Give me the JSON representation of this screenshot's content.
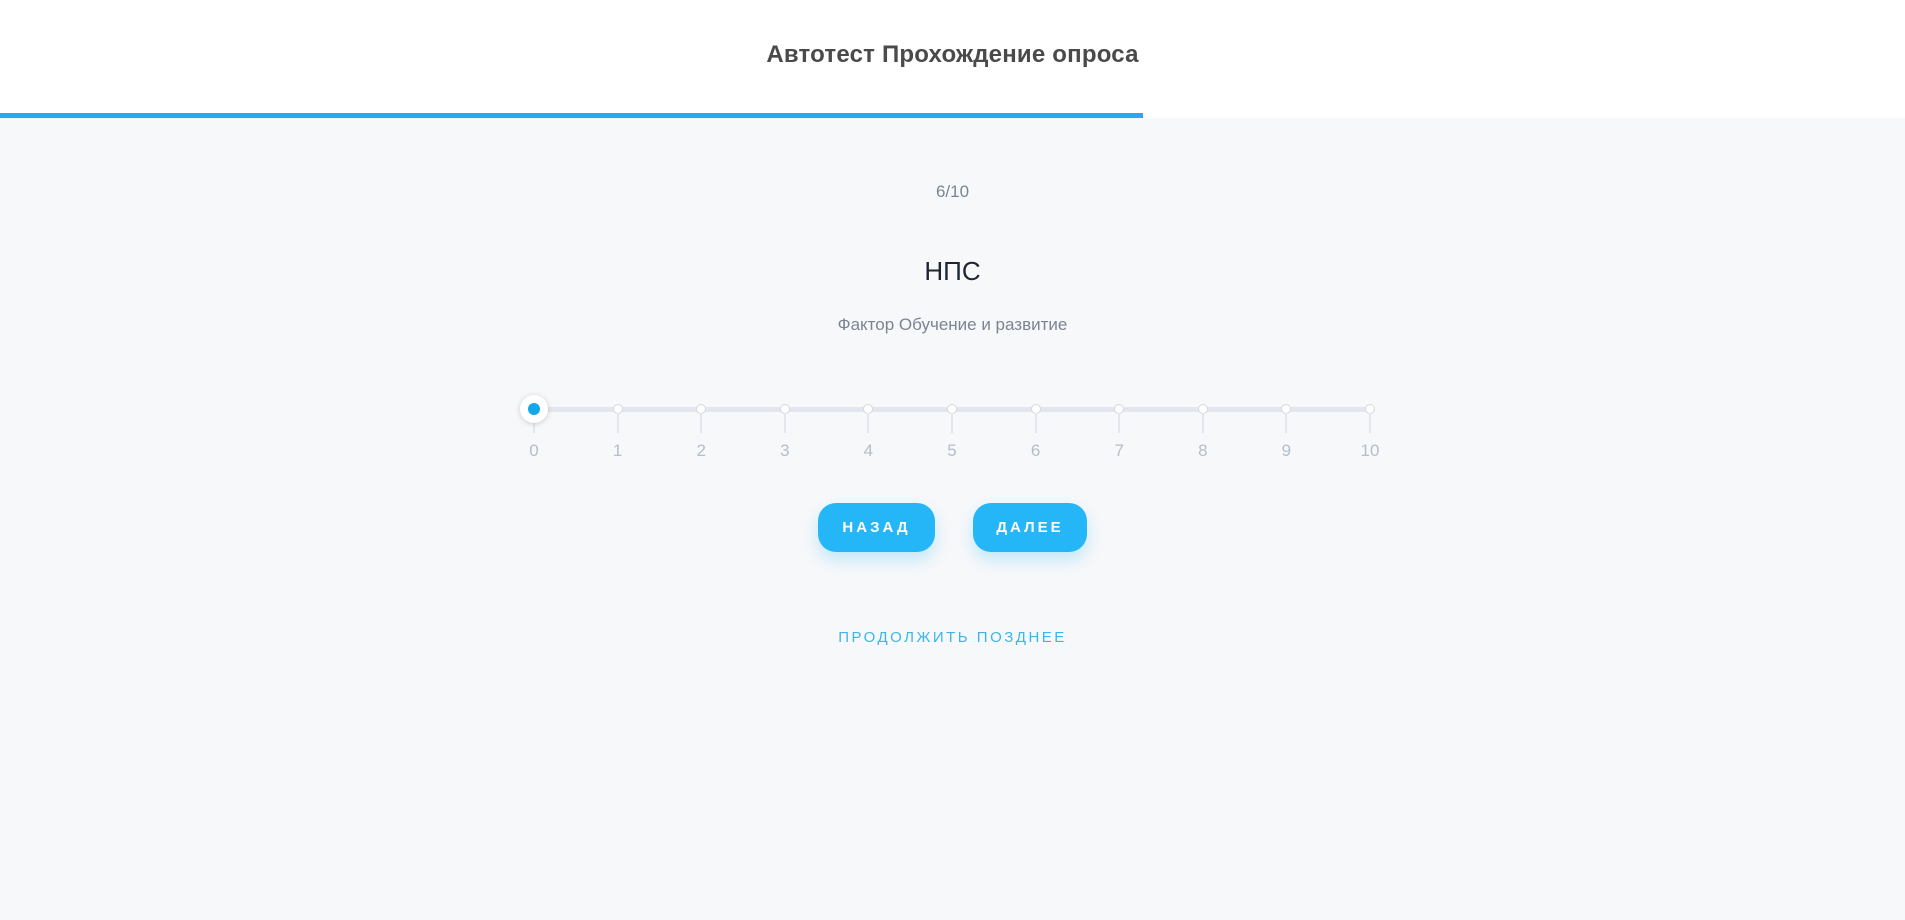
{
  "header": {
    "title": "Автотест Прохождение опроса"
  },
  "progress": {
    "fraction": 0.6,
    "color": "#27aaf0"
  },
  "question": {
    "counter": "6/10",
    "title": "НПС",
    "subtitle": "Фактор Обучение и развитие"
  },
  "scale": {
    "min": 0,
    "max": 10,
    "selected": 0,
    "labels": [
      "0",
      "1",
      "2",
      "3",
      "4",
      "5",
      "6",
      "7",
      "8",
      "9",
      "10"
    ]
  },
  "buttons": {
    "back_label": "НАЗАД",
    "next_label": "ДАЛЕЕ",
    "accent": "#25b6f7"
  },
  "later_link": {
    "label": "ПРОДОЛЖИТЬ ПОЗДНЕЕ"
  }
}
